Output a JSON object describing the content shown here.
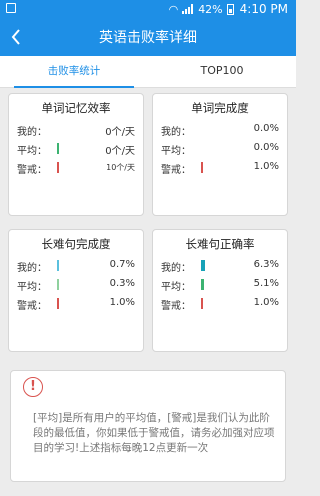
{
  "status_bar": {
    "battery": "42%",
    "time": "4:10 PM"
  },
  "header": {
    "back_icon": "chevron-left-icon",
    "title": "英语击败率详细"
  },
  "tabs": [
    {
      "label": "击败率统计",
      "active": true
    },
    {
      "label": "TOP100",
      "active": false
    }
  ],
  "cards": [
    {
      "title": "单词记忆效率",
      "rows": [
        {
          "label": "我的：",
          "value": "0个/天",
          "bar_color": ""
        },
        {
          "label": "平均：",
          "value": "0个/天",
          "bar_color": "#3cb371"
        },
        {
          "label": "警戒：",
          "value": "10个/天",
          "bar_color": "#d9534f"
        }
      ]
    },
    {
      "title": "单词完成度",
      "rows": [
        {
          "label": "我的：",
          "value": "0.0%",
          "bar_color": ""
        },
        {
          "label": "平均：",
          "value": "0.0%",
          "bar_color": ""
        },
        {
          "label": "警戒：",
          "value": "1.0%",
          "bar_color": "#d9534f"
        }
      ]
    },
    {
      "title": "长难句完成度",
      "rows": [
        {
          "label": "我的：",
          "value": "0.7%",
          "bar_color": "#5bc0de"
        },
        {
          "label": "平均：",
          "value": "0.3%",
          "bar_color": "#8fd19e"
        },
        {
          "label": "警戒：",
          "value": "1.0%",
          "bar_color": "#d9534f"
        }
      ]
    },
    {
      "title": "长难句正确率",
      "rows": [
        {
          "label": "我的：",
          "value": "6.3%",
          "bar_color": "#17a2b8"
        },
        {
          "label": "平均：",
          "value": "5.1%",
          "bar_color": "#3cb371"
        },
        {
          "label": "警戒：",
          "value": "1.0%",
          "bar_color": "#d9534f"
        }
      ]
    }
  ],
  "note": {
    "icon": "alert-icon",
    "text": "[平均]是所有用户的平均值，[警戒]是我们认为此阶段的最低值，你如果低于警戒值，请务必加强对应项目的学习!上述指标每晚12点更新一次"
  }
}
